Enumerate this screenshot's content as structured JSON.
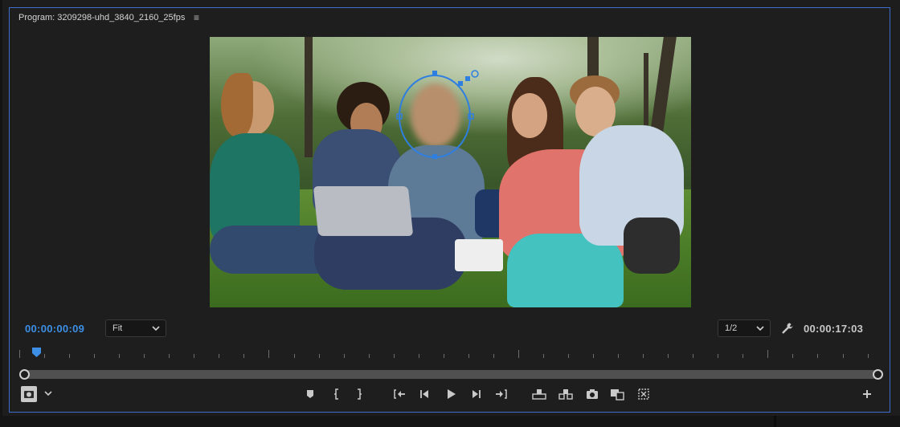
{
  "panel": {
    "title": "Program: 3209298-uhd_3840_2160_25fps",
    "menu_icon": "hamburger-menu-icon"
  },
  "timecode": {
    "current": "00:00:00:09",
    "duration": "00:00:17:03"
  },
  "zoom": {
    "label": "Fit",
    "options_visible": [
      "Fit"
    ]
  },
  "resolution": {
    "label": "1/2"
  },
  "playhead": {
    "position_fraction": 0.02
  },
  "colors": {
    "accent": "#3d8fe6",
    "panel_border": "#3d6ec9",
    "mask_outline": "#2f7fe0"
  },
  "toolbar": {
    "buttons": [
      {
        "name": "add-marker-button",
        "icon": "marker-icon"
      },
      {
        "name": "mark-in-button",
        "icon": "mark-in-icon"
      },
      {
        "name": "mark-out-button",
        "icon": "mark-out-icon"
      },
      {
        "name": "go-to-in-button",
        "icon": "go-to-in-icon"
      },
      {
        "name": "step-back-button",
        "icon": "step-back-icon"
      },
      {
        "name": "play-button",
        "icon": "play-icon"
      },
      {
        "name": "step-forward-button",
        "icon": "step-forward-icon"
      },
      {
        "name": "go-to-out-button",
        "icon": "go-to-out-icon"
      },
      {
        "name": "lift-button",
        "icon": "lift-icon"
      },
      {
        "name": "extract-button",
        "icon": "extract-icon"
      },
      {
        "name": "export-frame-button",
        "icon": "camera-icon"
      },
      {
        "name": "comparison-view-button",
        "icon": "comparison-view-icon"
      },
      {
        "name": "toggle-proxies-button",
        "icon": "proxy-icon"
      },
      {
        "name": "button-editor-button",
        "icon": "plus-icon"
      }
    ]
  }
}
